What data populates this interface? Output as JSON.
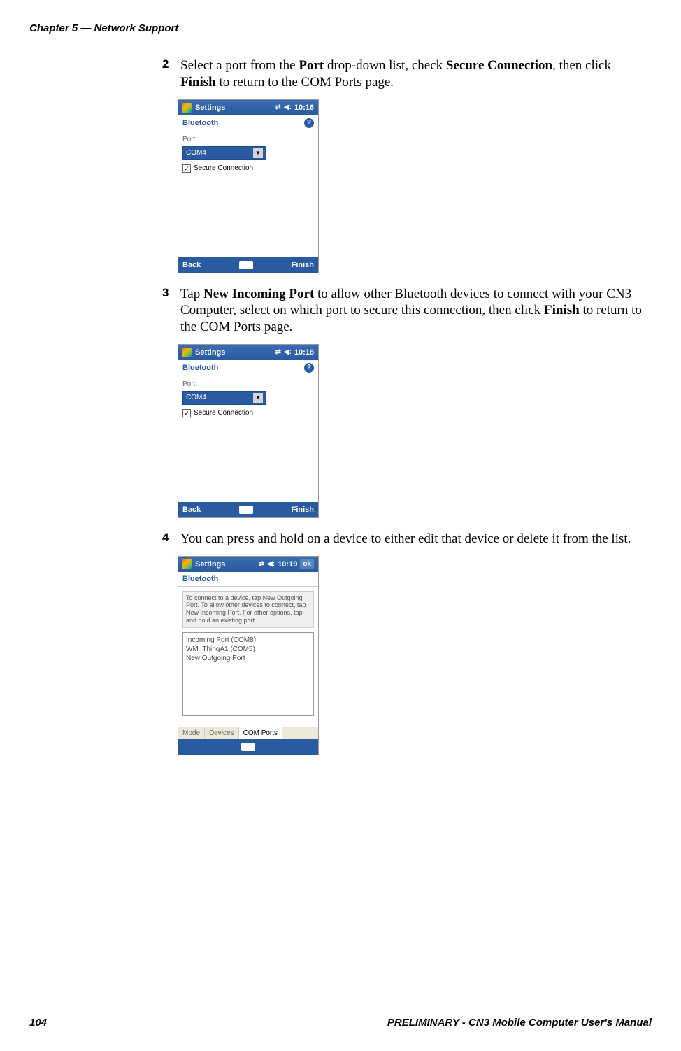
{
  "chapter_header": "Chapter 5 — Network Support",
  "steps": {
    "s2": {
      "num": "2",
      "text_parts": {
        "p1": "Select a port from the ",
        "b1": "Port",
        "p2": " drop-down list, check ",
        "b2": "Secure Connection",
        "p3": ", then click ",
        "b3": "Finish",
        "p4": " to return to the COM Ports page."
      }
    },
    "s3": {
      "num": "3",
      "text_parts": {
        "p1": "Tap ",
        "b1": "New Incoming Port",
        "p2": " to allow other Bluetooth devices to connect with your CN3 Computer, select on which port to secure this connection, then click ",
        "b2": "Finish",
        "p3": " to return to the COM Ports page."
      }
    },
    "s4": {
      "num": "4",
      "text_parts": {
        "p1": "You can press and hold on a device to either edit that device or delete it from the list."
      }
    }
  },
  "screenshot1": {
    "title": "Settings",
    "time": "10:16",
    "header": "Bluetooth",
    "port_label": "Port:",
    "port_value": "COM4",
    "checkbox_label": "Secure Connection",
    "back": "Back",
    "finish": "Finish"
  },
  "screenshot2": {
    "title": "Settings",
    "time": "10:18",
    "header": "Bluetooth",
    "port_label": "Port:",
    "port_value": "COM4",
    "checkbox_label": "Secure Connection",
    "back": "Back",
    "finish": "Finish"
  },
  "screenshot3": {
    "title": "Settings",
    "time": "10:19",
    "ok": "ok",
    "header": "Bluetooth",
    "info_text": "To connect to a device, tap New Outgoing Port. To allow other devices to connect, tap New Incoming Port. For other options, tap and hold an existing port.",
    "list_items": {
      "i1": "Incoming Port (COM8)",
      "i2": "WM_ThingA1 (COM5)",
      "i3": "New Outgoing Port"
    },
    "tabs": {
      "t1": "Mode",
      "t2": "Devices",
      "t3": "COM Ports"
    }
  },
  "footer": {
    "page": "104",
    "title": "PRELIMINARY - CN3 Mobile Computer User's Manual"
  }
}
